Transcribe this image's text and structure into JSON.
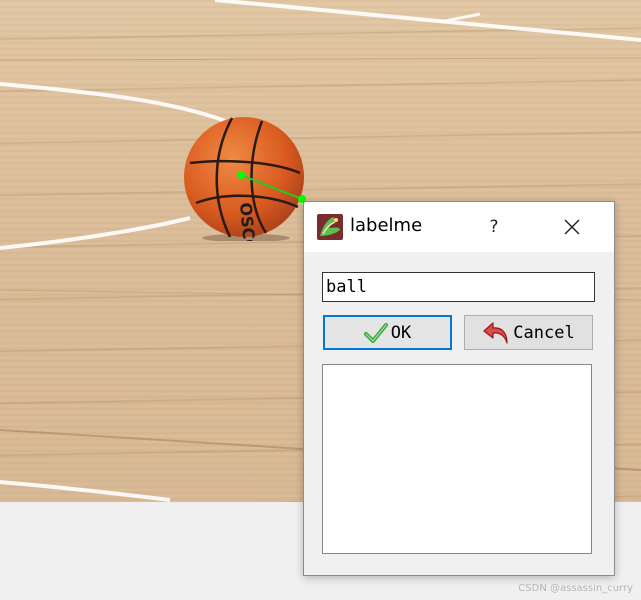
{
  "canvas": {
    "colors": {
      "floor": "#dcc09b",
      "court_line": "#ffffff",
      "annotation_line": "#22cc22",
      "annotation_point": "#00ff00",
      "ball": "#e0692a"
    },
    "ball_text": "OSCO"
  },
  "dialog": {
    "title": "labelme",
    "app_icon": "labelme-icon",
    "help_label": "?",
    "close_icon": "close-icon",
    "label_input": {
      "value": "ball",
      "placeholder": ""
    },
    "ok_button": {
      "label": "OK",
      "icon": "checkmark-icon"
    },
    "cancel_button": {
      "label": "Cancel",
      "icon": "undo-arrow-icon"
    },
    "label_list": [],
    "accent_color": "#0078d7"
  },
  "watermark": "CSDN @assassin_curry"
}
